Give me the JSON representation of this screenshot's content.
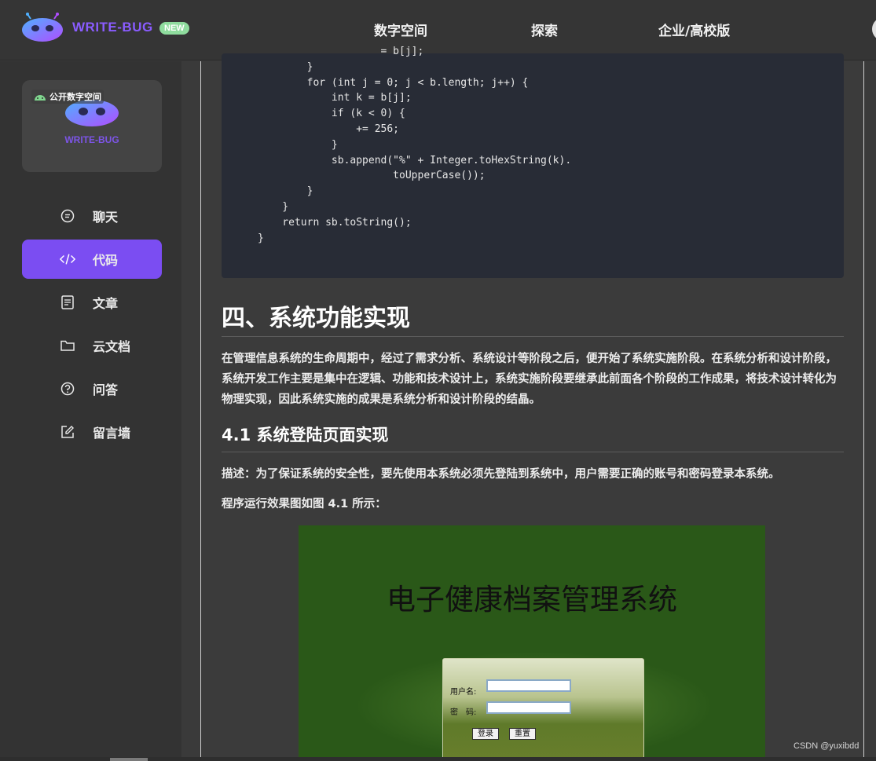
{
  "header": {
    "brand": "WRITE-BUG",
    "badge": "NEW",
    "nav": [
      "数字空间",
      "探索",
      "企业/高校版"
    ]
  },
  "sidebar": {
    "space_tag": "公开数字空间",
    "space_brand": "WRITE-BUG",
    "items": [
      {
        "label": "聊天",
        "icon": "chat-icon",
        "active": false
      },
      {
        "label": "代码",
        "icon": "code-icon",
        "active": true
      },
      {
        "label": "文章",
        "icon": "article-icon",
        "active": false
      },
      {
        "label": "云文档",
        "icon": "folder-icon",
        "active": false
      },
      {
        "label": "问答",
        "icon": "question-icon",
        "active": false
      },
      {
        "label": "留言墙",
        "icon": "edit-icon",
        "active": false
      }
    ]
  },
  "article": {
    "code": "                    = b[j];\n        }\n        for (int j = 0; j < b.length; j++) {\n            int k = b[j];\n            if (k < 0) {\n                += 256;\n            }\n            sb.append(\"%\" + Integer.toHexString(k).\n                      toUpperCase());\n        }\n    }\n    return sb.toString();\n}",
    "heading": "四、系统功能实现",
    "intro": "在管理信息系统的生命周期中，经过了需求分析、系统设计等阶段之后，便开始了系统实施阶段。在系统分析和设计阶段，系统开发工作主要是集中在逻辑、功能和技术设计上，系统实施阶段要继承此前面各个阶段的工作成果，将技术设计转化为物理实现，因此系统实施的成果是系统分析和设计阶段的结晶。",
    "subheading": "4.1 系统登陆页面实现",
    "description": "描述：为了保证系统的安全性，要先使用本系统必须先登陆到系统中，用户需要正确的账号和密码登录本系统。",
    "figure_caption": "程序运行效果图如图 4.1 所示："
  },
  "figure": {
    "title": "电子健康档案管理系统",
    "username_label": "用户名:",
    "password_label": "密　码:",
    "login_button": "登录",
    "reset_button": "重置"
  },
  "watermark": "CSDN @yuxibdd",
  "colors": {
    "accent": "#7b4df2",
    "brand": "#8a5cff",
    "badge": "#8fdc9e",
    "code_bg": "#282c36"
  }
}
